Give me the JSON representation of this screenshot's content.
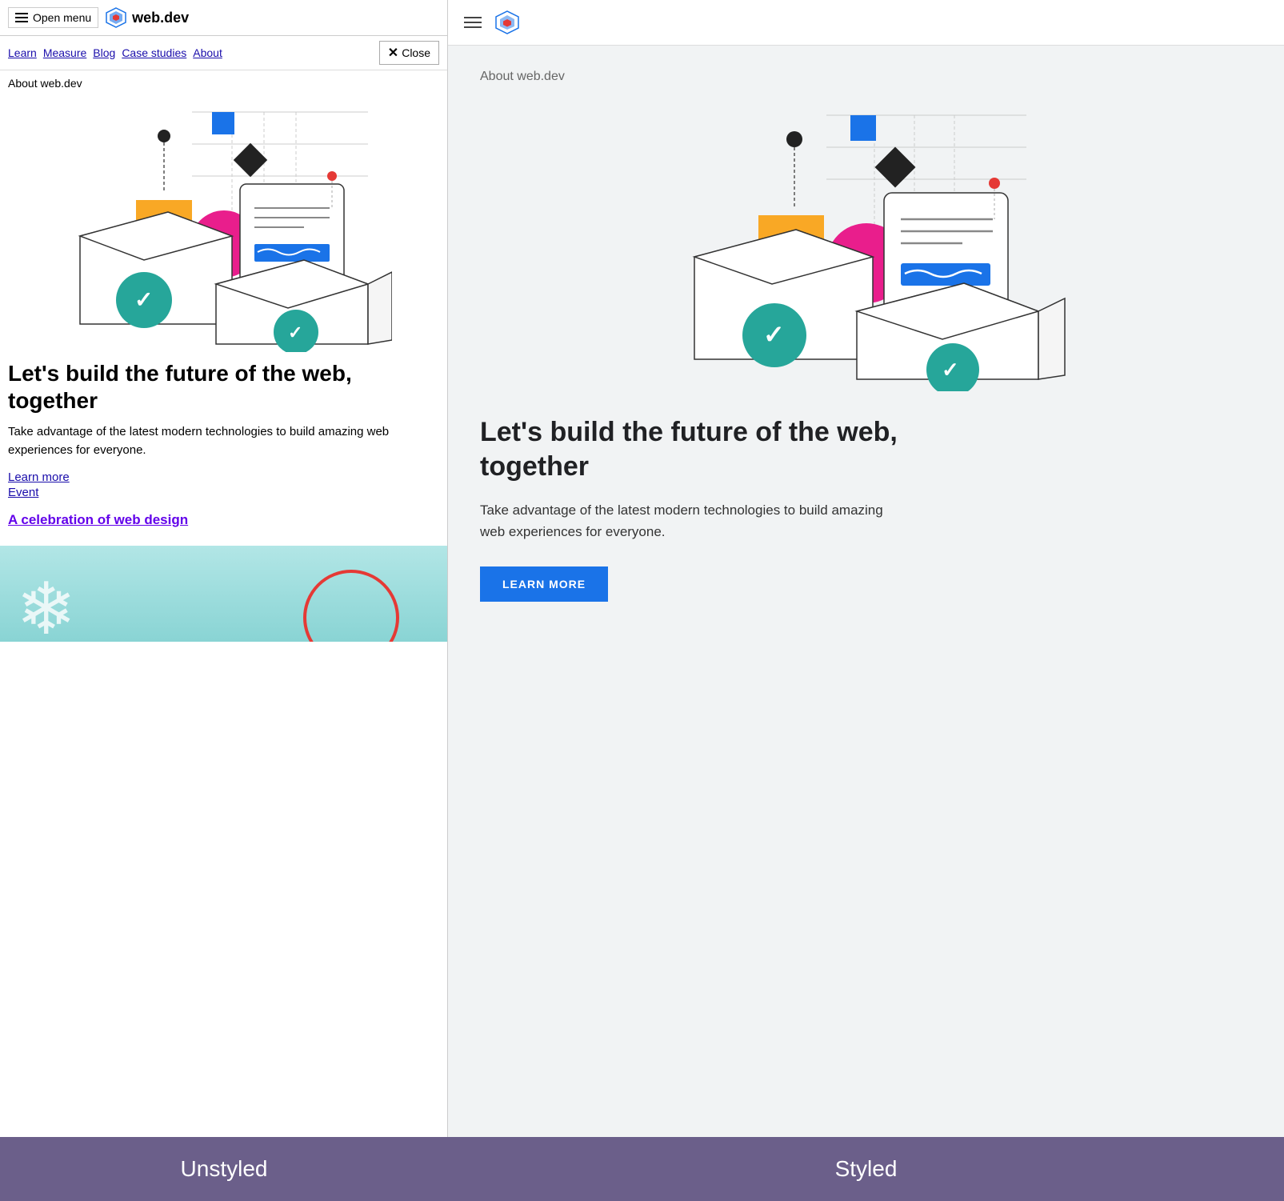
{
  "left": {
    "header": {
      "menu_button": "Open menu",
      "logo_text": "web.dev"
    },
    "nav": {
      "items": [
        "Learn",
        "Measure",
        "Blog",
        "Case studies",
        "About"
      ],
      "close_label": "Close"
    },
    "about_label": "About web.dev",
    "hero": {
      "title": "Let's build the future of the web, together",
      "description": "Take advantage of the latest modern technologies to build amazing web experiences for everyone.",
      "link1": "Learn more",
      "link2": "Event",
      "celebration_link": "A celebration of web design"
    }
  },
  "right": {
    "about_label": "About web.dev",
    "hero": {
      "title": "Let's build the future of the web, together",
      "description": "Take advantage of the latest modern technologies to build amazing web experiences for everyone.",
      "cta_button": "LEARN MORE"
    }
  },
  "bottom": {
    "unstyled_label": "Unstyled",
    "styled_label": "Styled"
  },
  "icons": {
    "hamburger": "☰",
    "close": "✕",
    "checkmark": "✓"
  }
}
